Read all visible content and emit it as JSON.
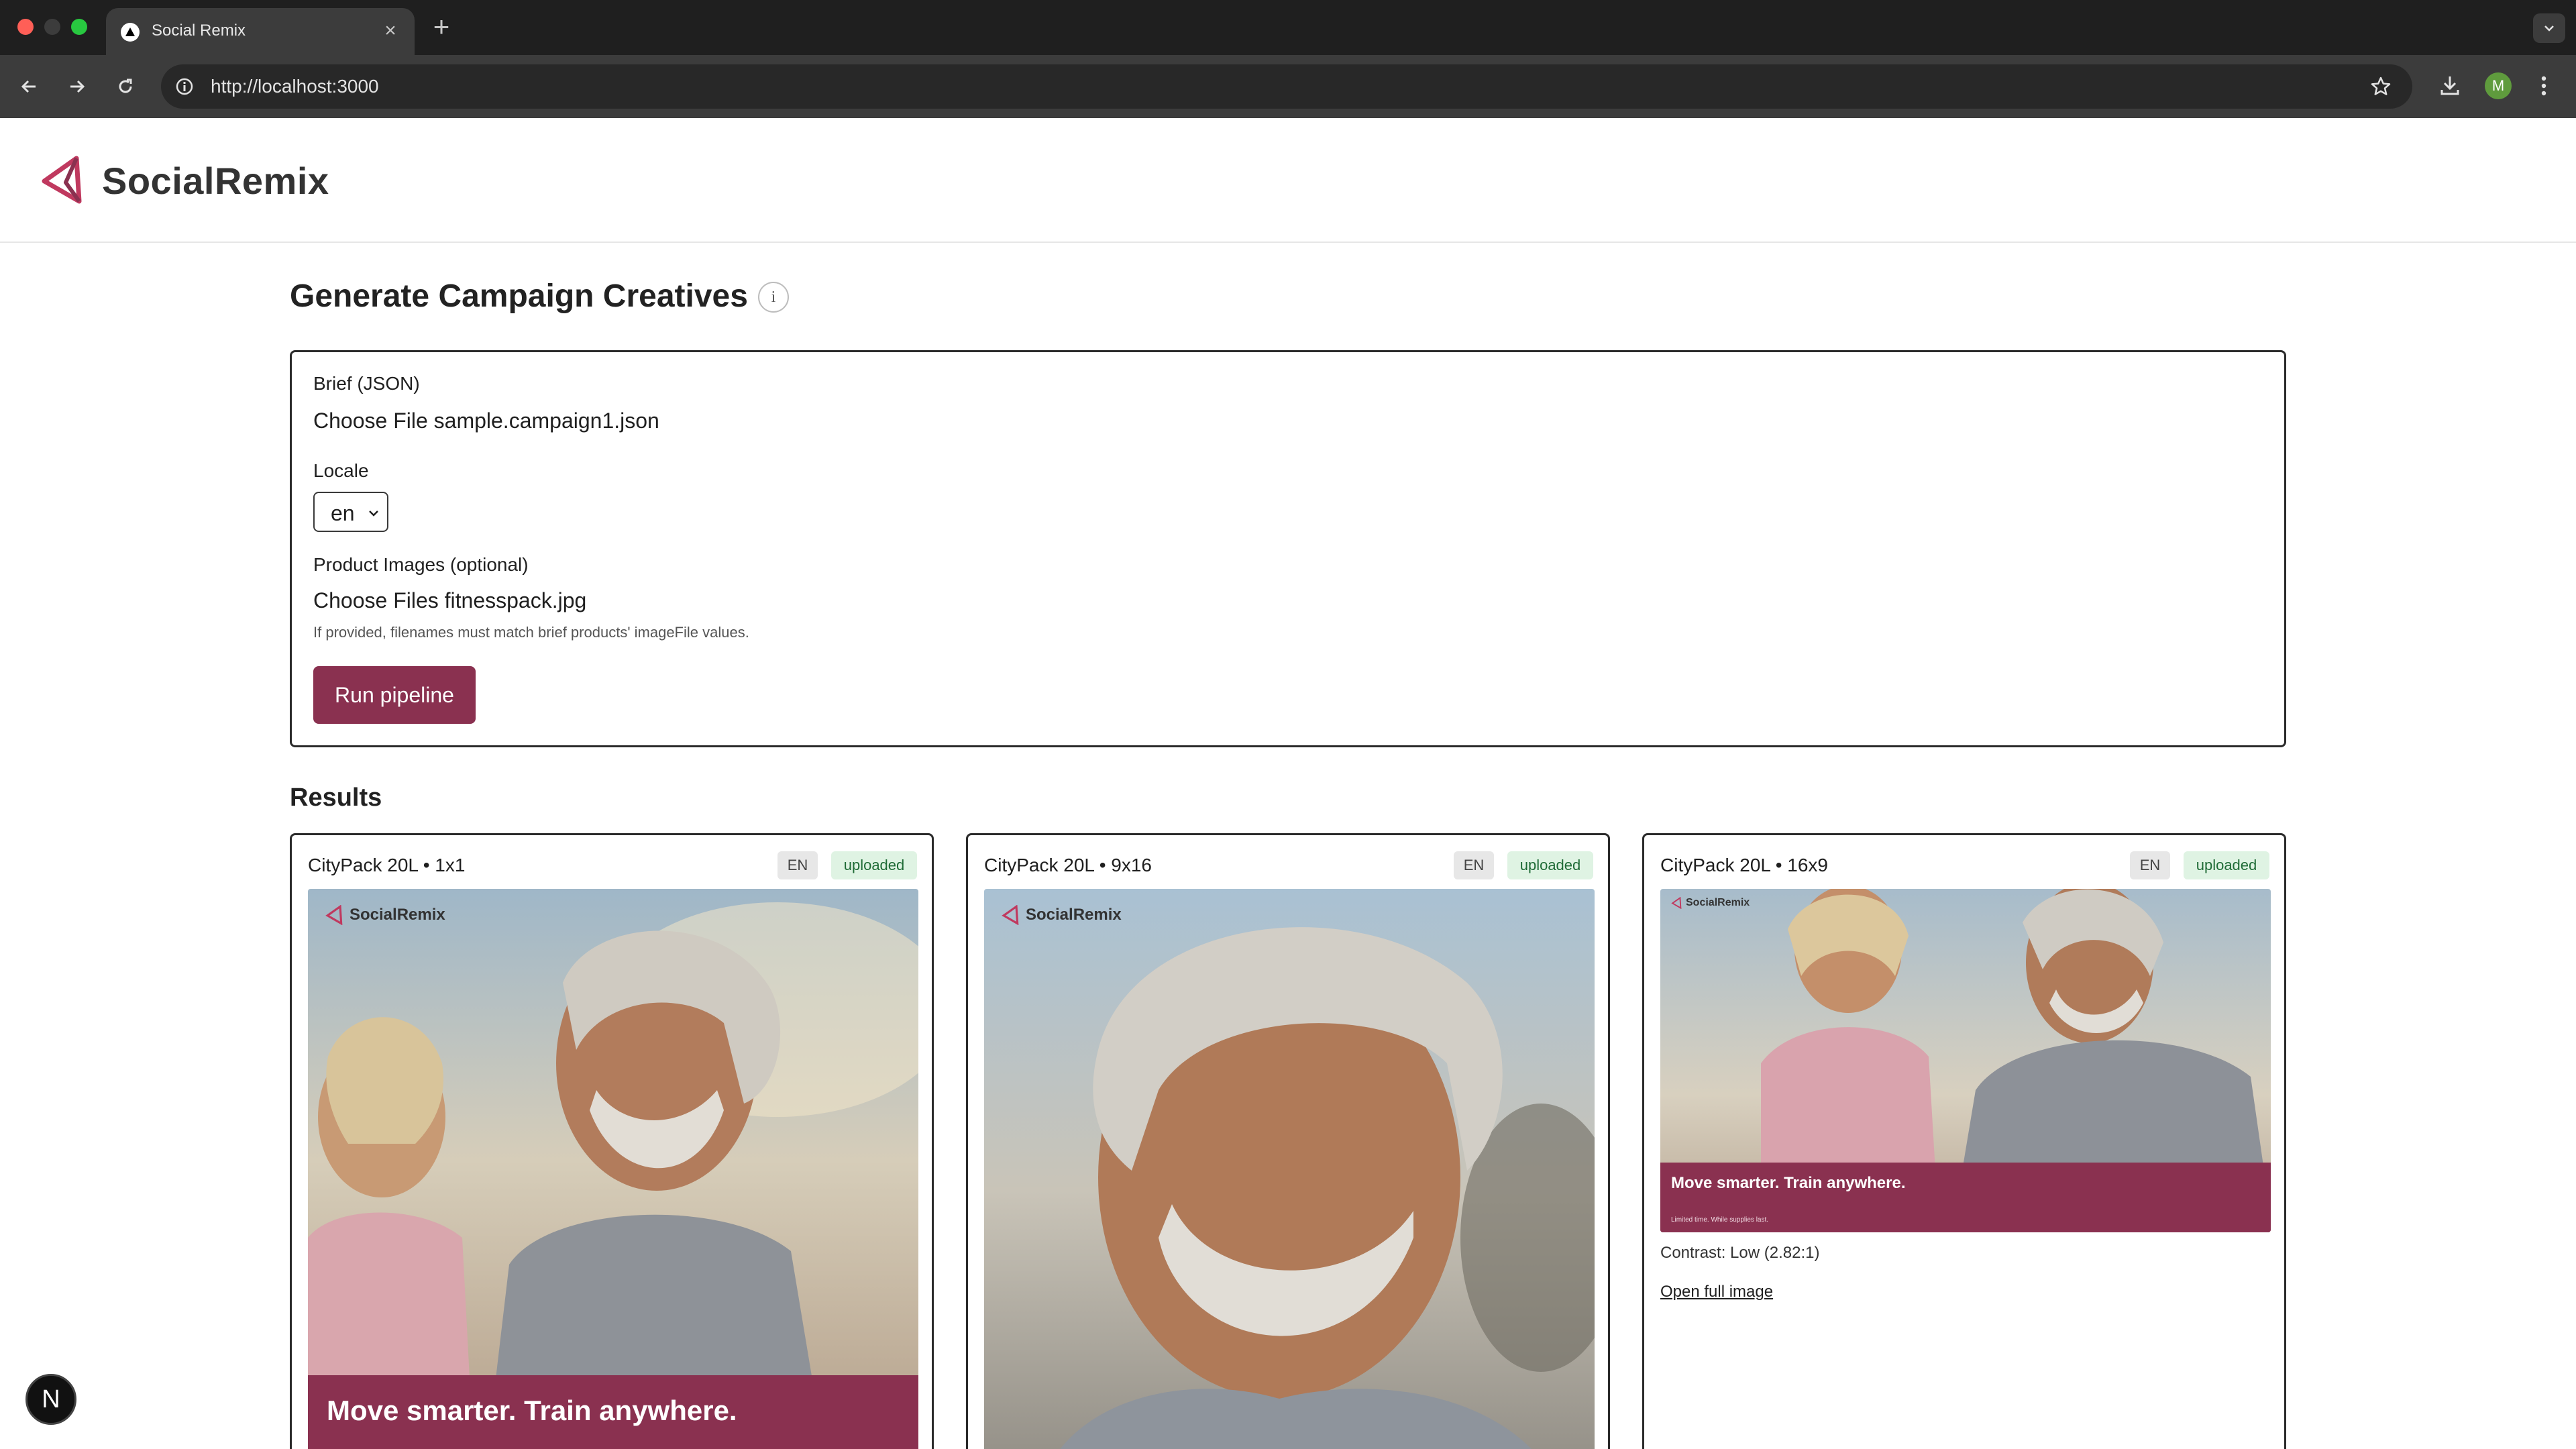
{
  "browser": {
    "tab_title": "Social Remix",
    "url": "http://localhost:3000",
    "profile_initial": "M"
  },
  "app": {
    "brand_name": "SocialRemix",
    "brand_color": "#8a3150",
    "page_title": "Generate Campaign Creatives"
  },
  "form": {
    "brief_label": "Brief (JSON)",
    "brief_button": "Choose File",
    "brief_file": "sample.campaign1.json",
    "locale_label": "Locale",
    "locale_value": "en",
    "images_label": "Product Images (optional)",
    "images_button": "Choose Files",
    "images_file": "fitnesspack.jpg",
    "hint": "If provided, filenames must match brief products' imageFile values.",
    "run_button": "Run pipeline"
  },
  "results": {
    "title": "Results",
    "cards": [
      {
        "title": "CityPack 20L • 1x1",
        "locale": "EN",
        "status": "uploaded",
        "logo_text": "SocialRemix",
        "headline": "Move smarter. Train anywhere."
      },
      {
        "title": "CityPack 20L • 9x16",
        "locale": "EN",
        "status": "uploaded",
        "logo_text": "SocialRemix"
      },
      {
        "title": "CityPack 20L • 16x9",
        "locale": "EN",
        "status": "uploaded",
        "logo_text": "SocialRemix",
        "headline": "Move smarter. Train anywhere.",
        "fineprint": "Limited time. While supplies last.",
        "contrast": "Contrast: Low (2.82:1)",
        "link": "Open full image"
      }
    ]
  },
  "dev_badge": "N"
}
